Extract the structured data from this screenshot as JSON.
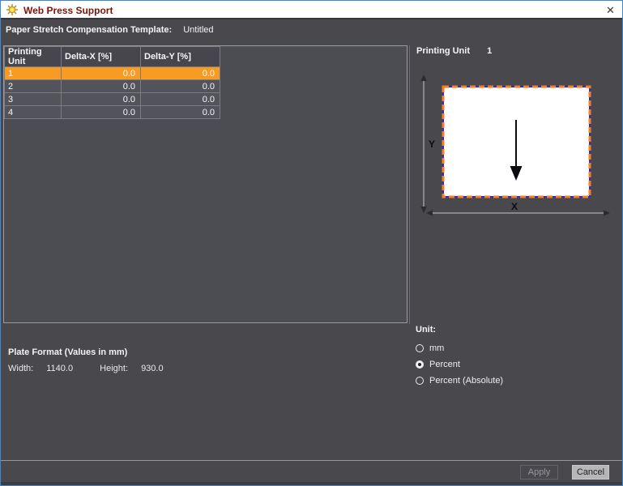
{
  "window": {
    "title": "Web Press Support",
    "close_glyph": "✕",
    "border_color": "#3d89cf",
    "title_color": "#7d130b"
  },
  "header": {
    "template_label": "Paper Stretch Compensation Template:",
    "template_value": "Untitled"
  },
  "table": {
    "columns": [
      "Printing Unit",
      "Delta-X [%]",
      "Delta-Y [%]"
    ],
    "rows": [
      {
        "unit": "1",
        "dx": "0.0",
        "dy": "0.0",
        "selected": true
      },
      {
        "unit": "2",
        "dx": "0.0",
        "dy": "0.0",
        "selected": false
      },
      {
        "unit": "3",
        "dx": "0.0",
        "dy": "0.0",
        "selected": false
      },
      {
        "unit": "4",
        "dx": "0.0",
        "dy": "0.0",
        "selected": false
      }
    ],
    "selected_color": "#f89b22"
  },
  "plate_format": {
    "title": "Plate Format (Values in mm)",
    "width_label": "Width:",
    "width_value": "1140.0",
    "height_label": "Height:",
    "height_value": "930.0"
  },
  "preview": {
    "printing_unit_label": "Printing Unit",
    "printing_unit_value": "1",
    "x_axis_label": "X",
    "y_axis_label": "Y",
    "plate_border_blue": "#2d2dcc",
    "plate_border_orange": "#f57f23"
  },
  "unit": {
    "label": "Unit:",
    "options": [
      {
        "label": "mm",
        "selected": false
      },
      {
        "label": "Percent",
        "selected": true
      },
      {
        "label": "Percent (Absolute)",
        "selected": false
      }
    ]
  },
  "footer": {
    "apply_label": "Apply",
    "cancel_label": "Cancel"
  }
}
